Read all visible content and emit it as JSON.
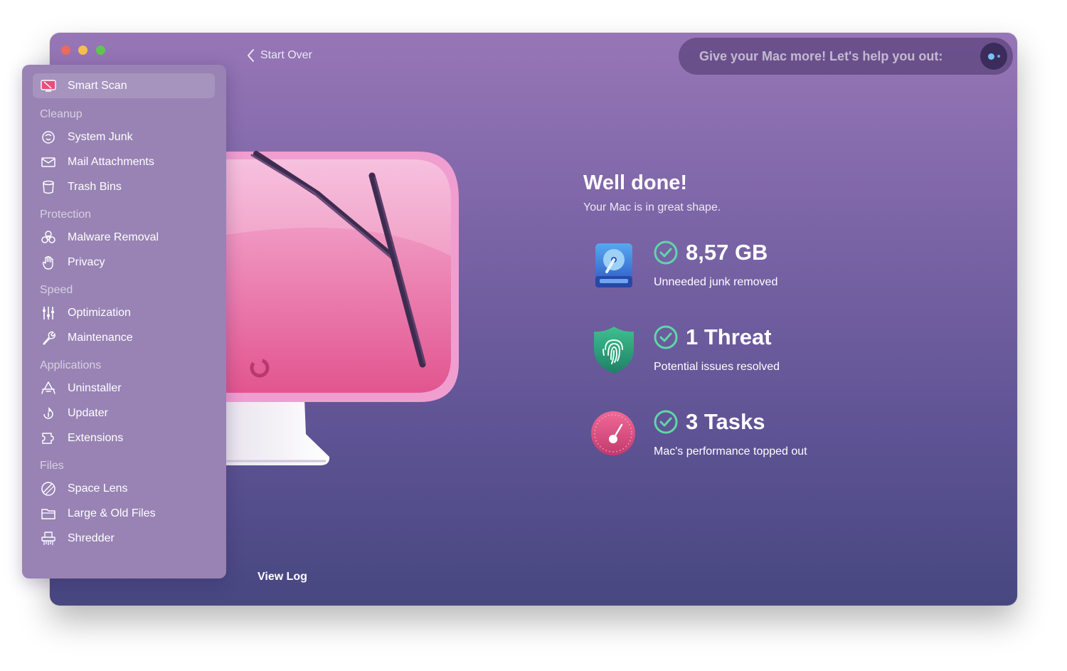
{
  "header": {
    "back_label": "Start Over",
    "promo_text": "Give your Mac more! Let's help you out:"
  },
  "sidebar": {
    "smart_scan": "Smart Scan",
    "sections": {
      "cleanup": "Cleanup",
      "protection": "Protection",
      "speed": "Speed",
      "applications": "Applications",
      "files": "Files"
    },
    "items": {
      "system_junk": "System Junk",
      "mail_attachments": "Mail Attachments",
      "trash_bins": "Trash Bins",
      "malware_removal": "Malware Removal",
      "privacy": "Privacy",
      "optimization": "Optimization",
      "maintenance": "Maintenance",
      "uninstaller": "Uninstaller",
      "updater": "Updater",
      "extensions": "Extensions",
      "space_lens": "Space Lens",
      "large_old_files": "Large & Old Files",
      "shredder": "Shredder"
    }
  },
  "main": {
    "title": "Well done!",
    "subtitle": "Your Mac is in great shape.",
    "stats": [
      {
        "value": "8,57 GB",
        "desc": "Unneeded junk removed",
        "icon": "hard-drive-icon"
      },
      {
        "value": "1 Threat",
        "desc": "Potential issues resolved",
        "icon": "shield-fingerprint-icon"
      },
      {
        "value": "3 Tasks",
        "desc": "Mac's performance topped out",
        "icon": "speedometer-icon"
      }
    ],
    "view_log": "View Log"
  },
  "colors": {
    "window_top": "#9776b6",
    "window_bottom": "#474781",
    "sidebar": "#9883b4",
    "check_green": "#5ed7a8",
    "monitor_pink": "#f088bf"
  }
}
